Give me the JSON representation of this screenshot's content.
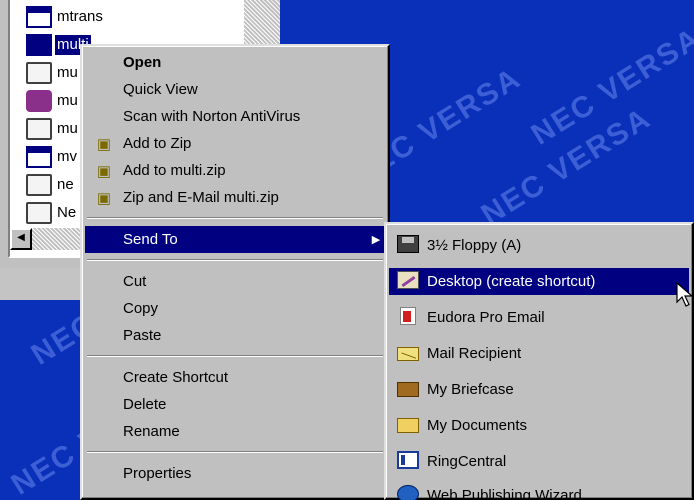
{
  "desktop": {
    "watermark_text": "NEC VERSA"
  },
  "explorer": {
    "files": [
      {
        "name": "mtrans",
        "icon": "window-icon"
      },
      {
        "name": "multi",
        "icon": "window-icon",
        "selected": true
      },
      {
        "name": "mu",
        "icon": "image-icon"
      },
      {
        "name": "mu",
        "icon": "book-icon"
      },
      {
        "name": "mu",
        "icon": "image-icon"
      },
      {
        "name": "mv",
        "icon": "window-icon"
      },
      {
        "name": "ne",
        "icon": "image-icon"
      },
      {
        "name": "Ne",
        "icon": "text-file-icon"
      }
    ]
  },
  "context_menu": {
    "open": "Open",
    "quick_view": "Quick View",
    "scan": "Scan with Norton AntiVirus",
    "add_to_zip": "Add to Zip",
    "add_to_multi_zip": "Add to multi.zip",
    "zip_email": "Zip and E-Mail multi.zip",
    "send_to": "Send To",
    "cut": "Cut",
    "copy": "Copy",
    "paste": "Paste",
    "create_shortcut": "Create Shortcut",
    "delete": "Delete",
    "rename": "Rename",
    "properties": "Properties"
  },
  "sendto_menu": {
    "items": [
      {
        "label": "3½ Floppy (A)",
        "icon": "floppy-icon"
      },
      {
        "label": "Desktop (create shortcut)",
        "icon": "desktop-shortcut-icon",
        "highlighted": true
      },
      {
        "label": "Eudora Pro Email",
        "icon": "eudora-icon"
      },
      {
        "label": "Mail Recipient",
        "icon": "mail-icon"
      },
      {
        "label": "My Briefcase",
        "icon": "briefcase-icon"
      },
      {
        "label": "My Documents",
        "icon": "folder-icon"
      },
      {
        "label": "RingCentral",
        "icon": "ringcentral-icon"
      },
      {
        "label": "Web Publishing Wizard",
        "icon": "web-icon"
      }
    ]
  },
  "colors": {
    "desktop_blue": "#0a2fb8",
    "menu_gray": "#c0c0c0",
    "highlight": "#000080"
  }
}
